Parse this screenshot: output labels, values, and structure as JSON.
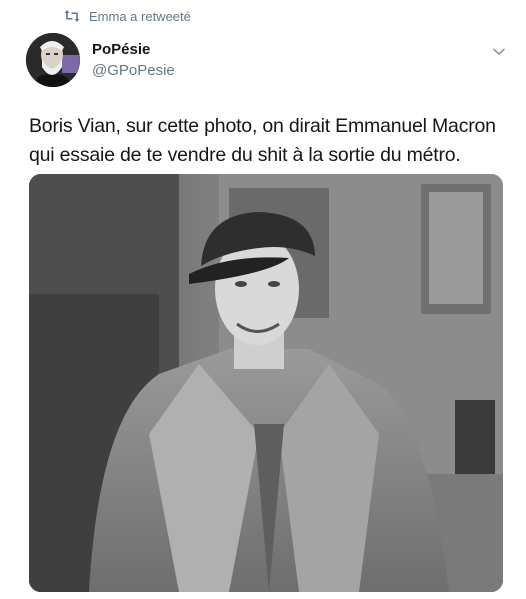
{
  "retweet": {
    "icon": "retweet-icon",
    "text": "Emma a retweeté"
  },
  "author": {
    "avatar": "avatar-portrait",
    "display_name": "PoPésie",
    "handle": "@GPoPesie",
    "menu_icon": "chevron-down-icon"
  },
  "tweet": {
    "line1": "Boris Vian, sur cette photo, on dirait Emmanuel Macron",
    "line2": "qui essaie de te vendre du shit à la sortie du métro."
  },
  "media": {
    "type": "black-and-white photo",
    "subject": "man in flat cap and trench coat in front of building"
  }
}
